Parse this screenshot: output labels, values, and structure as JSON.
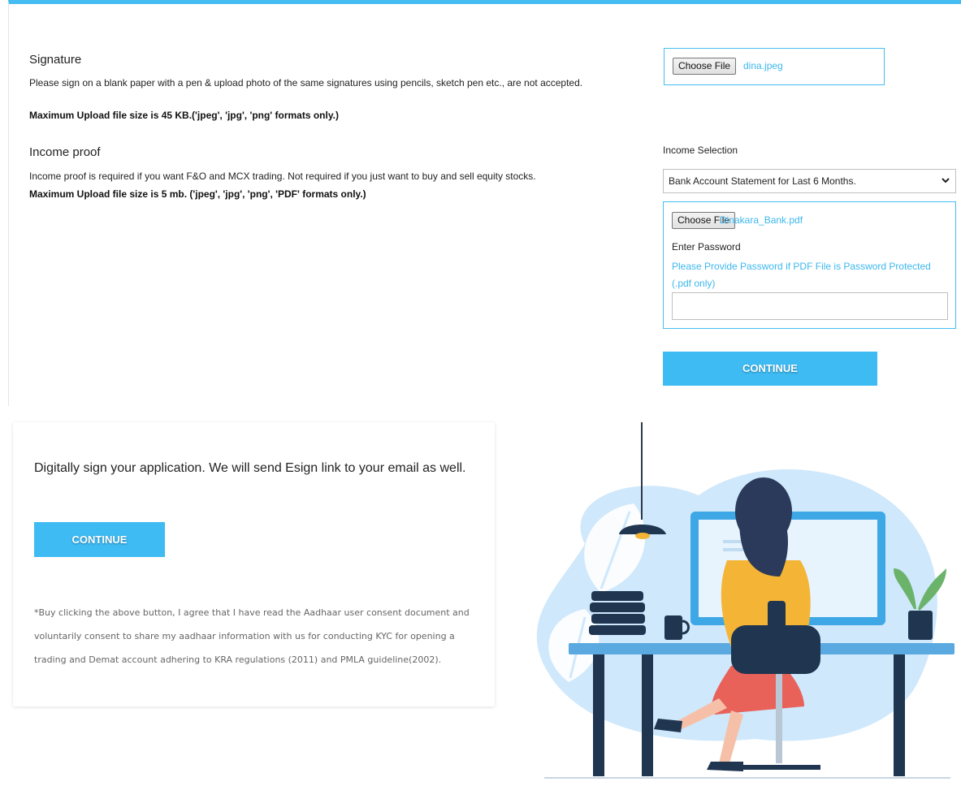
{
  "signature": {
    "title": "Signature",
    "description": "Please sign on a blank paper with a pen & upload photo of the same signatures using pencils, sketch pen etc., are not accepted.",
    "note": "Maximum Upload file size is 45 KB.('jpeg', 'jpg', 'png' formats only.)",
    "choose_label": "Choose File",
    "file_name": "dina.jpeg"
  },
  "income": {
    "title": "Income proof",
    "description": "Income proof is required if you want F&O and MCX trading. Not required if you just want to buy and sell equity stocks.",
    "note": "Maximum Upload file size is 5 mb. ('jpeg', 'jpg', 'png', 'PDF' formats only.)",
    "selection_label": "Income Selection",
    "selected_option": "Bank Account Statement for Last 6 Months.",
    "choose_label": "Choose File",
    "file_name": "Dinakara_Bank.pdf",
    "password_label": "Enter Password",
    "password_hint": "Please Provide Password if PDF File is Password Protected (.pdf only)",
    "password_value": "",
    "continue_label": "CONTINUE"
  },
  "esign": {
    "text": "Digitally sign your application. We will send Esign link to your email as well.",
    "continue_label": "CONTINUE",
    "consent": "*Buy clicking the above button, I agree that I have read the Aadhaar user consent document and voluntarily consent to share my aadhaar information with us for conducting KYC for opening a trading and Demat account adhering to KRA regulations (2011) and PMLA guideline(2002)."
  },
  "colors": {
    "accent": "#3ebbf3",
    "link": "#3db7ee",
    "illustration_blue": "#1f4e79",
    "illustration_light": "#cfe8fb"
  },
  "icons": {
    "select_arrow": "chevron-down-icon"
  }
}
